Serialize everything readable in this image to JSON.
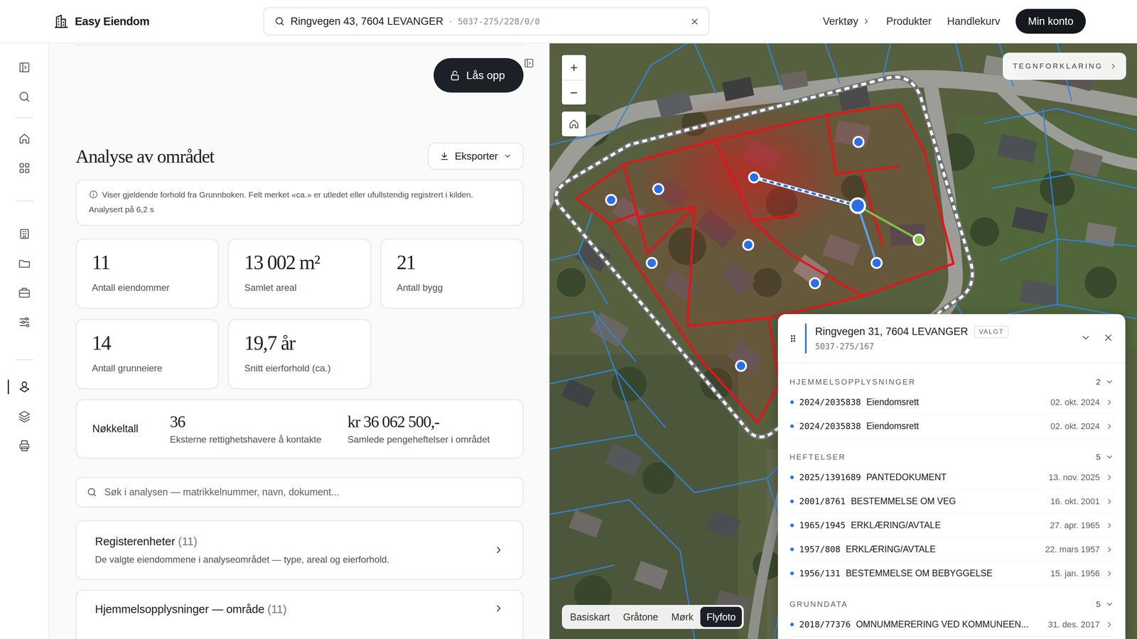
{
  "app": {
    "name": "Easy Eiendom"
  },
  "search": {
    "value": "Ringvegen 43, 7604 LEVANGER",
    "separator": "·",
    "code": "5037-275/228/0/0",
    "clear": "×"
  },
  "nav": [
    {
      "label": "Verktøy",
      "kind": "menu"
    },
    {
      "label": "Produkter",
      "kind": "link"
    },
    {
      "label": "Handlekurv",
      "kind": "link"
    }
  ],
  "account_button": "Min konto",
  "rail": [
    {
      "selected": false
    },
    {
      "selected": false
    },
    {
      "selected": false
    },
    {
      "selected": false
    },
    {
      "selected": false
    },
    {
      "selected": false
    },
    {
      "selected": false
    },
    {
      "selected": false
    },
    {
      "selected": true
    },
    {
      "selected": false
    },
    {
      "selected": false
    }
  ],
  "unlock_button": "Lås opp",
  "analysis": {
    "title": "Analyse av området",
    "export_button": "Eksporter",
    "info": {
      "text": "Viser gjeldende forhold fra Grunnboken. Felt merket «ca.» er utledet eller ufullstendig registrert i kilden.",
      "time": "Analysert på 6,2 s"
    },
    "stats": [
      {
        "value": "11",
        "label": "Antall eiendommer"
      },
      {
        "value": "13 002 m²",
        "label": "Samlet areal"
      },
      {
        "value": "21",
        "label": "Antall bygg"
      },
      {
        "value": "14",
        "label": "Antall grunneiere"
      },
      {
        "value": "19,7 år",
        "label": "Snitt eierforhold (ca.)"
      }
    ],
    "key_figures": {
      "label": "Nøkkeltall",
      "items": [
        {
          "value": "36",
          "label": "Eksterne rettighetshavere å kontakte"
        },
        {
          "value": "kr 36 062 500,-",
          "label": "Samlede pengeheftelser i området"
        }
      ]
    },
    "search_placeholder": "Søk i analysen — matrikkelnummer, navn, dokument...",
    "sections": [
      {
        "title": "Registerenheter",
        "count": "(11)",
        "description": "De valgte eiendommene i analyseområdet — type, areal og eierforhold."
      },
      {
        "title": "Hjemmelsopplysninger — område",
        "count": "(11)"
      }
    ]
  },
  "map": {
    "legend_button": "TEGNFORKLARING",
    "zoom_in": "+",
    "zoom_out": "−",
    "basemaps": [
      {
        "label": "Basiskart",
        "selected": false
      },
      {
        "label": "Gråtone",
        "selected": false
      },
      {
        "label": "Mørk",
        "selected": false
      },
      {
        "label": "Flyfoto",
        "selected": true
      }
    ],
    "panel": {
      "title": "Ringvegen 31, 7604 LEVANGER",
      "badge": "VALGT",
      "id": "5037-275/167",
      "groups": [
        {
          "title": "HJEMMELSOPPLYSNINGER",
          "count": "2",
          "expanded": true,
          "rows": [
            {
              "doc": "2024/2035838",
              "type": "Eiendomsrett",
              "date": "02. okt. 2024"
            },
            {
              "doc": "2024/2035838",
              "type": "Eiendomsrett",
              "date": "02. okt. 2024"
            }
          ]
        },
        {
          "title": "HEFTELSER",
          "count": "5",
          "expanded": true,
          "rows": [
            {
              "doc": "2025/1391689",
              "type": "PANTEDOKUMENT",
              "date": "13. nov. 2025"
            },
            {
              "doc": "2001/8761",
              "type": "BESTEMMELSE OM VEG",
              "date": "16. okt. 2001"
            },
            {
              "doc": "1965/1945",
              "type": "ERKLÆRING/AVTALE",
              "date": "27. apr. 1965"
            },
            {
              "doc": "1957/808",
              "type": "ERKLÆRING/AVTALE",
              "date": "22. mars 1957"
            },
            {
              "doc": "1956/131",
              "type": "BESTEMMELSE OM BEBYGGELSE",
              "date": "15. jan. 1956"
            }
          ]
        },
        {
          "title": "GRUNNDATA",
          "count": "5",
          "expanded": true,
          "rows": [
            {
              "doc": "2018/77376",
              "type": "OMNUMMERERING VED KOMMUNEEN...",
              "date": "31. des. 2017"
            }
          ]
        }
      ]
    }
  }
}
